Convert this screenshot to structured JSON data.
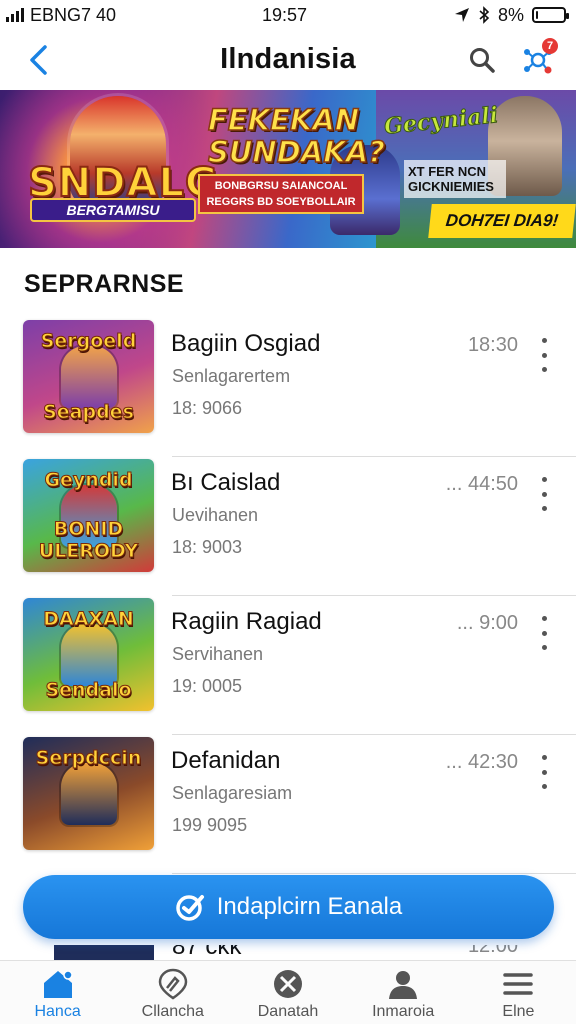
{
  "status_bar": {
    "carrier": "EBNG7 40",
    "time": "19:57",
    "battery": "8%",
    "battery_level": 0.08
  },
  "header": {
    "title": "Ilndanisia",
    "notification_badge": "7"
  },
  "banner": {
    "logo": "SNDALG",
    "logo_sub": "BERGTAMISU",
    "headline_1": "FEKEKAN",
    "headline_2": "SUNDAKA?",
    "strip_text": "BONBGRSU SAIANCOAL REGGRS BD SOEYBOLLAIR",
    "logo_2": "Gecyniali",
    "side_text": "XT FER NCN GICKNIEMIES",
    "cta": "DOH7EI DIA9!"
  },
  "section": {
    "title": "SEPRARNSE"
  },
  "games": [
    {
      "title": "Bagiin Osgiad",
      "subtitle": "Senlagarertem",
      "meta": "18: 9066",
      "time": "18:30",
      "thumb_text_top": "Sergoeld",
      "thumb_text_bottom": "Seapdes",
      "colors": [
        "#7d3fa8",
        "#c0478a",
        "#f0a24a"
      ]
    },
    {
      "title": "Bı Caislad",
      "subtitle": "Uevihanen",
      "meta": "18: 9003",
      "time": "... 44:50",
      "thumb_text_top": "Geyndid",
      "thumb_text_bottom": "BONID ULERODY",
      "colors": [
        "#3aa3e0",
        "#58b84a",
        "#d23a3a"
      ]
    },
    {
      "title": "Ragiin Ragiad",
      "subtitle": "Servihanen",
      "meta": "19: 0005",
      "time": "... 9:00",
      "thumb_text_top": "DAAXAN",
      "thumb_text_bottom": "Sendalo",
      "colors": [
        "#2f86d6",
        "#6fbd3a",
        "#f2c12e"
      ]
    },
    {
      "title": "Defanidan",
      "subtitle": "Senlagaresiam",
      "meta": "199 9095",
      "time": "... 42:30",
      "thumb_text_top": "Serpdccin",
      "thumb_text_bottom": "",
      "colors": [
        "#1f2d5a",
        "#8a4a2a",
        "#f0a038"
      ]
    }
  ],
  "peek_row": {
    "title": "87 ckk",
    "time": "12:00"
  },
  "cta_button": {
    "label": "Indaplcirn Eanala"
  },
  "bottom_nav": [
    {
      "label": "Hanca",
      "icon": "home-icon",
      "active": true
    },
    {
      "label": "Cllancha",
      "icon": "explore-icon",
      "active": false
    },
    {
      "label": "Danatah",
      "icon": "games-icon",
      "active": false
    },
    {
      "label": "Inmaroia",
      "icon": "profile-icon",
      "active": false
    },
    {
      "label": "Elne",
      "icon": "menu-icon",
      "active": false
    }
  ],
  "colors": {
    "accent": "#1a82e2",
    "badge": "#e53935",
    "text_secondary": "#777777"
  }
}
